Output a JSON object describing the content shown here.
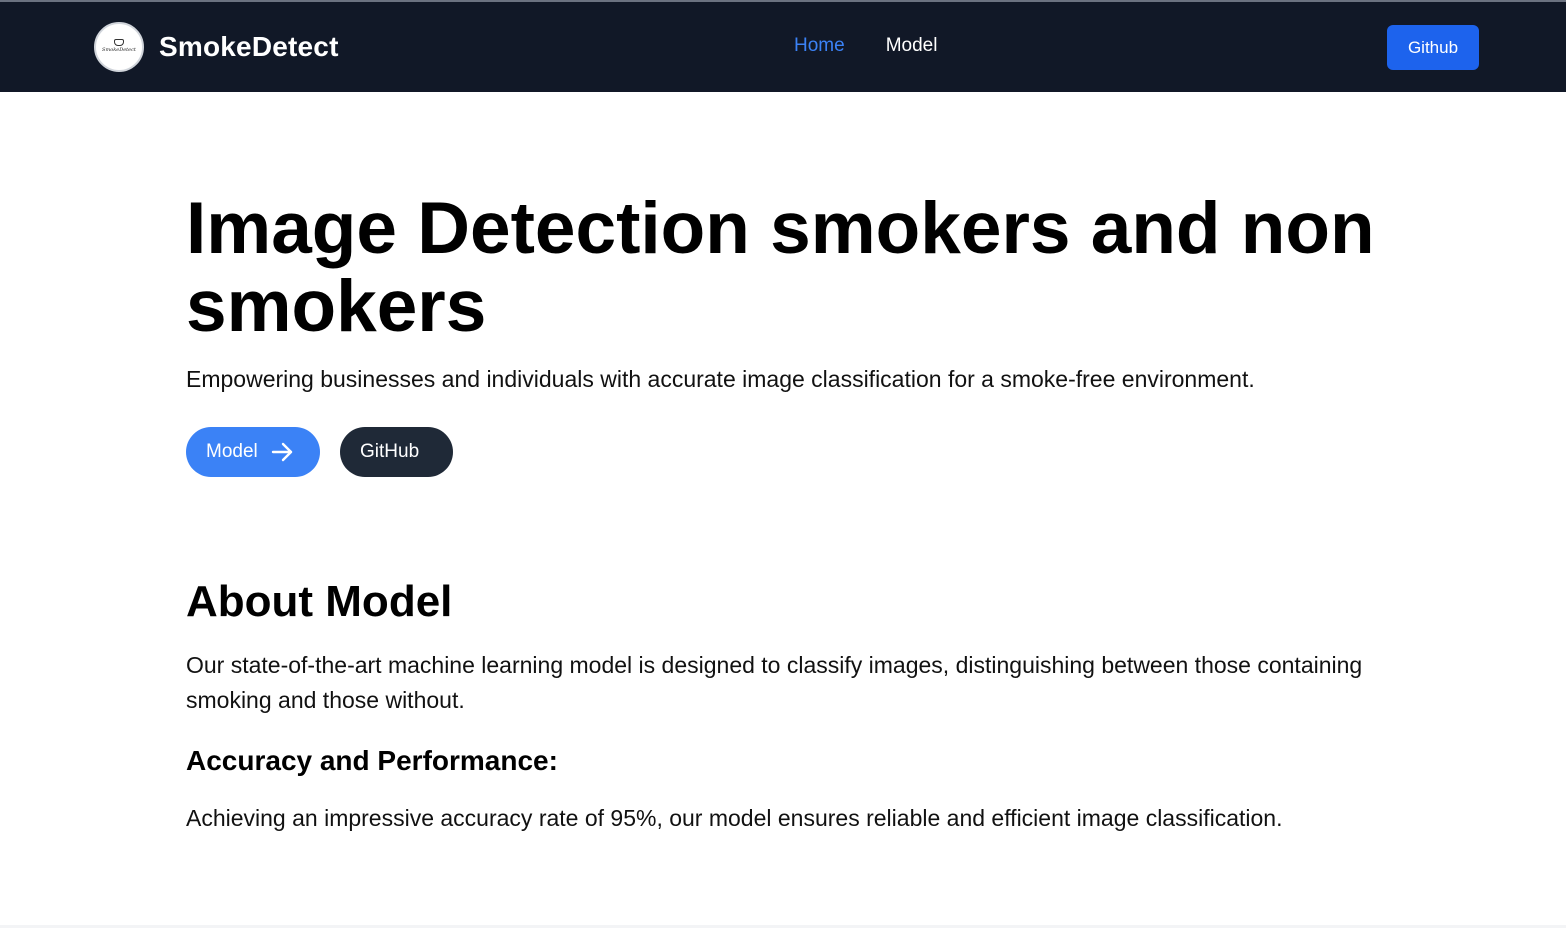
{
  "brand": {
    "name": "SmokeDetect",
    "logo_text": "SmokeDetect",
    "logo_icon": "logo-icon"
  },
  "nav": {
    "links": [
      {
        "label": "Home",
        "active": true
      },
      {
        "label": "Model",
        "active": false
      }
    ],
    "github_button": "Github"
  },
  "hero": {
    "title": "Image Detection smokers and non smokers",
    "subtitle": "Empowering businesses and individuals with accurate image classification for a smoke-free environment.",
    "primary_button": "Model",
    "primary_button_icon": "arrow-right-icon",
    "secondary_button": "GitHub"
  },
  "about": {
    "title": "About Model",
    "text": "Our state-of-the-art machine learning model is designed to classify images, distinguishing between those containing smoking and those without.",
    "perf_title": "Accuracy and Performance:",
    "perf_text": "Achieving an impressive accuracy rate of 95%, our model ensures reliable and efficient image classification."
  },
  "colors": {
    "navbar_bg": "#111827",
    "accent": "#3b82f6",
    "nav_button": "#1d63ed",
    "dark_button": "#1f2937"
  }
}
